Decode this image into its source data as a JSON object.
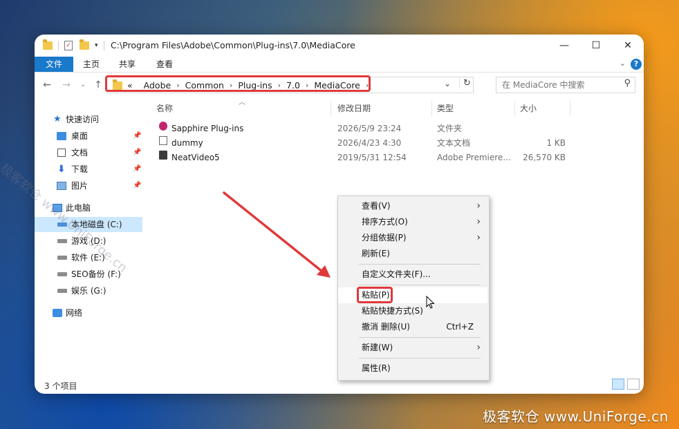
{
  "titlebar": {
    "path": "C:\\Program Files\\Adobe\\Common\\Plug-ins\\7.0\\MediaCore",
    "minimize": "—",
    "maximize": "☐",
    "close": "✕"
  },
  "ribbon": {
    "tabs": [
      "文件",
      "主页",
      "共享",
      "查看"
    ],
    "help": "?"
  },
  "address": {
    "prefix": "«",
    "crumbs": [
      "Adobe",
      "Common",
      "Plug-ins",
      "7.0",
      "MediaCore"
    ],
    "search_placeholder": "在 MediaCore 中搜索"
  },
  "sidebar": {
    "quick_access": "快速访问",
    "quick_items": [
      "桌面",
      "文档",
      "下载",
      "图片"
    ],
    "this_pc": "此电脑",
    "drives": [
      "本地磁盘 (C:)",
      "游戏 (D:)",
      "软件 (E:)",
      "SEO备份 (F:)",
      "娱乐 (G:)"
    ],
    "network": "网络"
  },
  "columns": {
    "name": "名称",
    "date": "修改日期",
    "type": "类型",
    "size": "大小"
  },
  "files": [
    {
      "name": "Sapphire Plug-ins",
      "date": "2026/5/9 23:24",
      "type": "文件夹",
      "size": ""
    },
    {
      "name": "dummy",
      "date": "2026/4/23 4:30",
      "type": "文本文档",
      "size": "1 KB"
    },
    {
      "name": "NeatVideo5",
      "date": "2019/5/31 12:54",
      "type": "Adobe Premiere...",
      "size": "26,570 KB"
    }
  ],
  "status": {
    "count": "3 个项目"
  },
  "context_menu": {
    "view": "查看(V)",
    "sort": "排序方式(O)",
    "group": "分组依据(P)",
    "refresh": "刷新(E)",
    "customize": "自定义文件夹(F)...",
    "paste": "粘贴(P)",
    "paste_shortcut": "粘贴快捷方式(S)",
    "undo": "撤消 删除(U)",
    "undo_shortcut": "Ctrl+Z",
    "new": "新建(W)",
    "properties": "属性(R)"
  },
  "watermark": {
    "bottom": "极客软仓 www.UniForge.cn",
    "diagonal": "极客软仓 www.UniForge.cn"
  },
  "colors": {
    "accent": "#1979ca",
    "highlight": "#e0393a",
    "selection": "#cce8ff"
  }
}
